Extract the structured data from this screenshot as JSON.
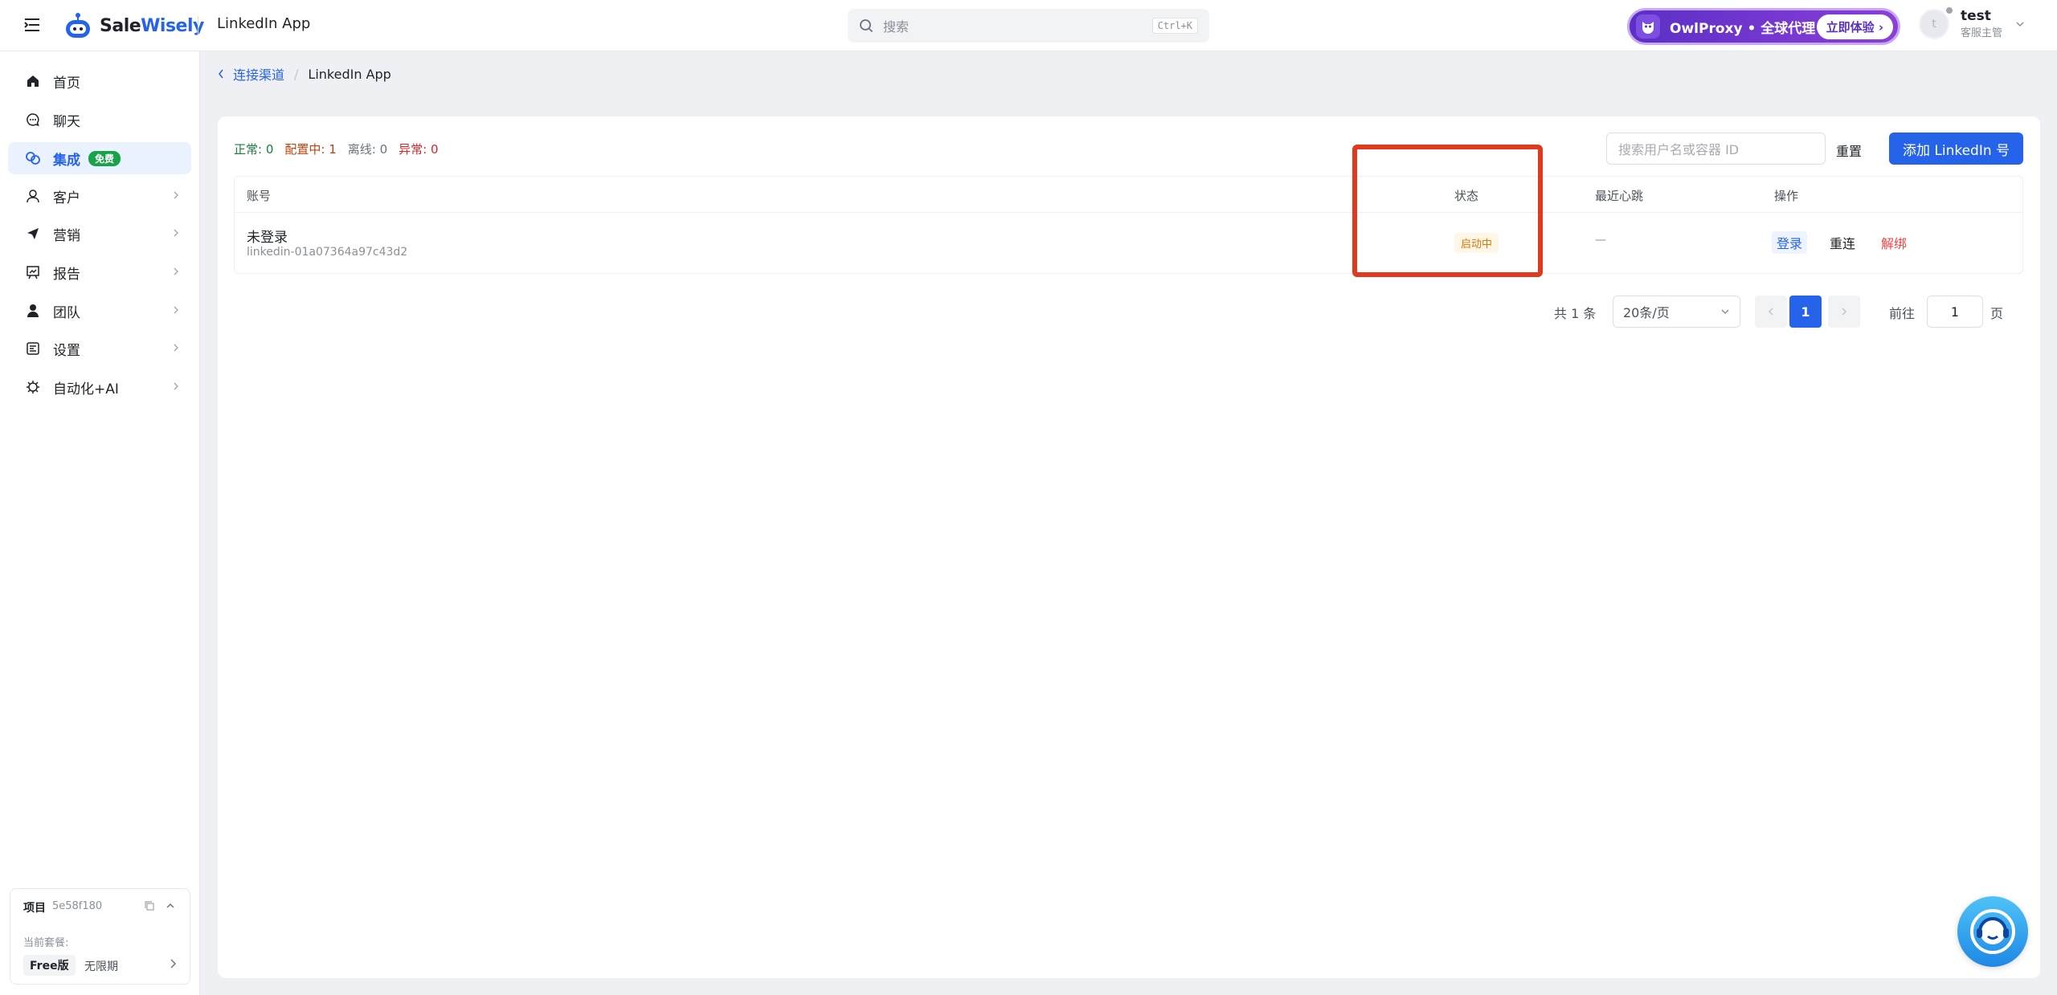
{
  "header": {
    "brand_part1": "Sale",
    "brand_part2": "Wisely",
    "app_title": "LinkedIn App",
    "search_placeholder": "搜索",
    "search_shortcut": "Ctrl+K",
    "promo_text": "OwlProxy • 全球代理",
    "promo_button": "立即体验",
    "user_name": "test",
    "user_role": "客服主管",
    "avatar_letter": "t"
  },
  "sidebar": {
    "items": [
      {
        "label": "首页",
        "icon": "home-icon"
      },
      {
        "label": "聊天",
        "icon": "chat-icon"
      },
      {
        "label": "集成",
        "icon": "integration-icon",
        "badge": "免费",
        "active": true
      },
      {
        "label": "客户",
        "icon": "user-icon"
      },
      {
        "label": "营销",
        "icon": "send-icon"
      },
      {
        "label": "报告",
        "icon": "report-icon"
      },
      {
        "label": "团队",
        "icon": "team-icon"
      },
      {
        "label": "设置",
        "icon": "settings-icon"
      },
      {
        "label": "自动化+AI",
        "icon": "chip-icon"
      }
    ],
    "project": {
      "title": "项目",
      "id": "5e58f180",
      "plan_label": "当前套餐:",
      "plan": "Free版",
      "term": "无限期"
    }
  },
  "breadcrumb": {
    "parent": "连接渠道",
    "current": "LinkedIn App"
  },
  "stats": {
    "normal": "正常: 0",
    "configuring": "配置中: 1",
    "offline": "离线: 0",
    "error": "异常: 0"
  },
  "toolbar": {
    "search_placeholder": "搜索用户名或容器 ID",
    "reset": "重置",
    "add": "添加 LinkedIn 号"
  },
  "table": {
    "columns": [
      "账号",
      "状态",
      "最近心跳",
      "操作"
    ],
    "rows": [
      {
        "name": "未登录",
        "id": "linkedin-01a07364a97c43d2",
        "status": "启动中",
        "heartbeat": "—",
        "actions": [
          "登录",
          "重连",
          "解绑"
        ]
      }
    ]
  },
  "pagination": {
    "total": "共 1 条",
    "page_size": "20条/页",
    "current_page": "1",
    "goto_label": "前往",
    "goto_value": "1",
    "page_suffix": "页"
  },
  "colors": {
    "primary": "#2563eb",
    "highlight_box": "#e03a1e",
    "free_badge": "#16a34a"
  }
}
